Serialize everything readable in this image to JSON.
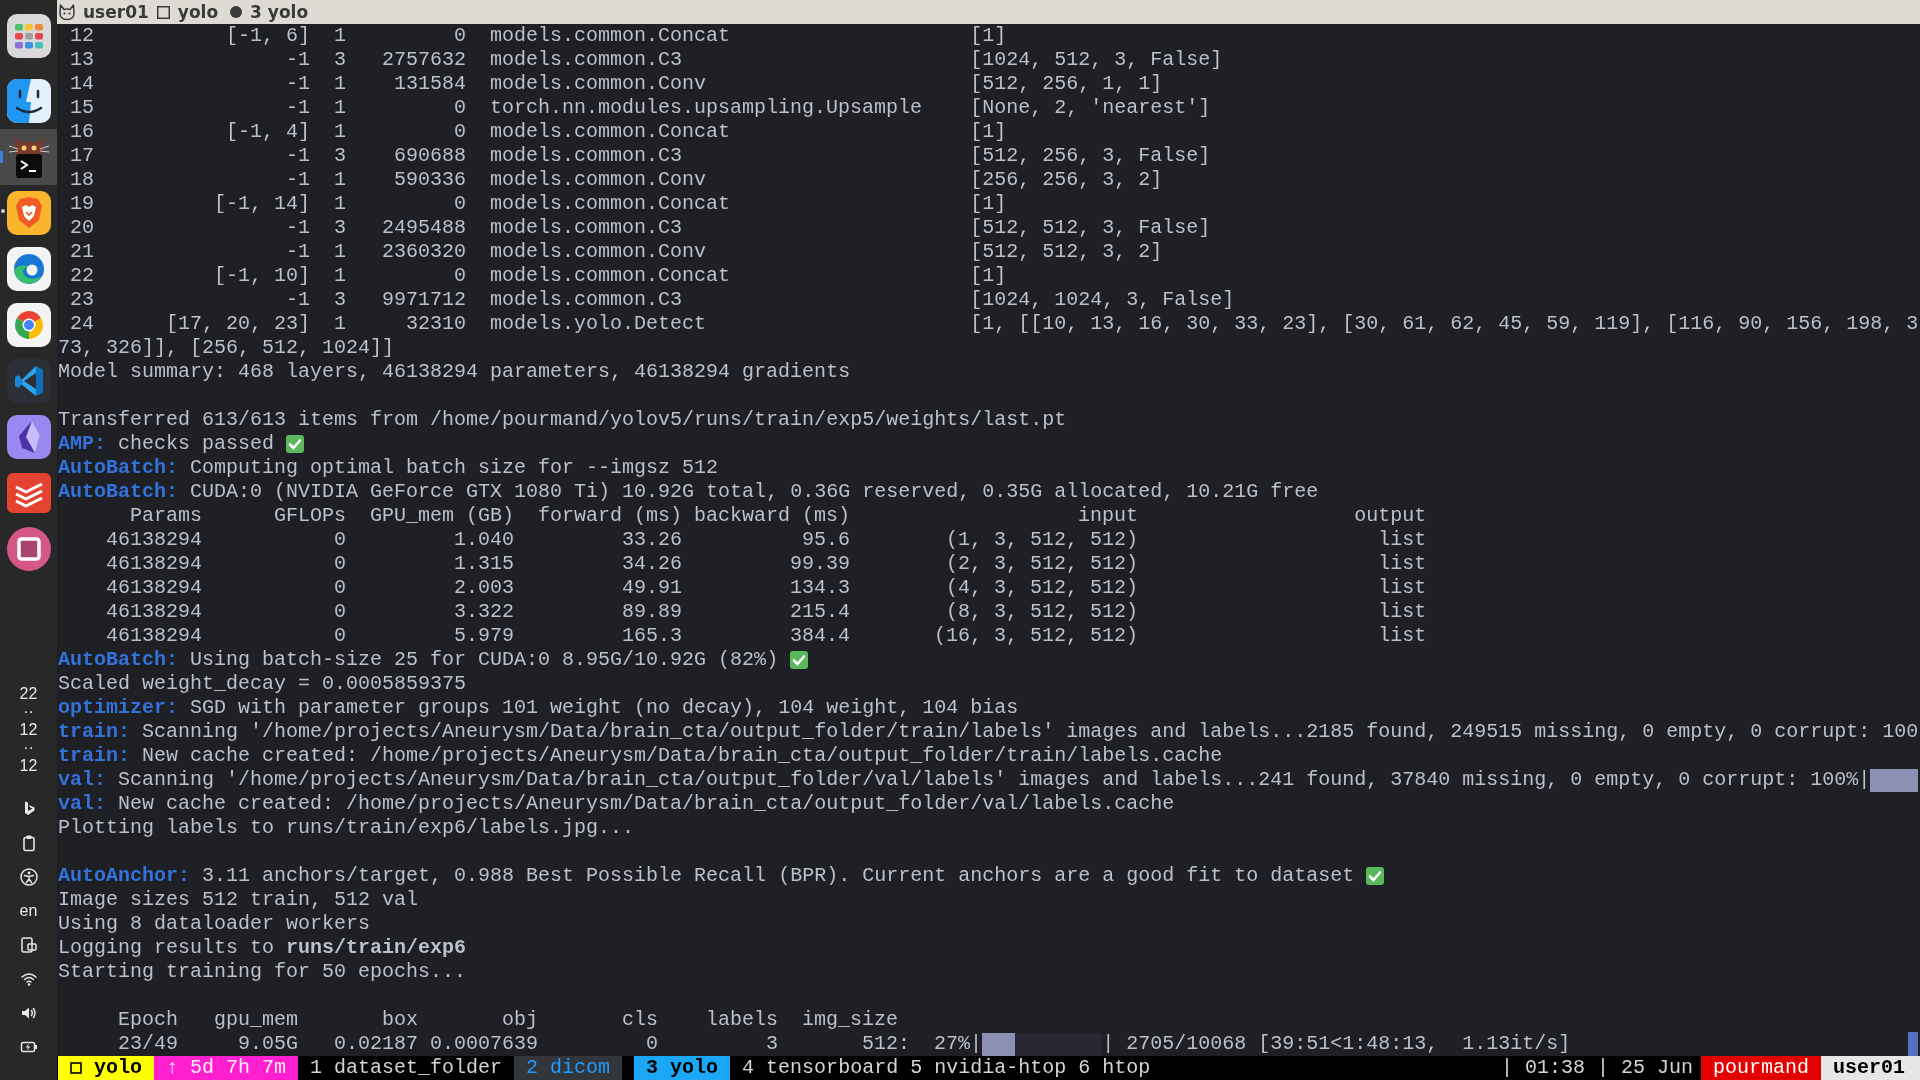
{
  "title_bar": {
    "user": "user01",
    "session": "yolo",
    "window": "3 yolo"
  },
  "dock": {
    "apps": [
      {
        "selected": false,
        "running": false
      },
      {
        "selected": false,
        "running": false
      },
      {
        "selected": true,
        "running": false
      },
      {
        "selected": false,
        "running": true
      },
      {
        "selected": false,
        "running": false
      },
      {
        "selected": false,
        "running": false
      },
      {
        "selected": false,
        "running": false
      },
      {
        "selected": false,
        "running": false
      },
      {
        "selected": false,
        "running": false
      },
      {
        "selected": false,
        "running": false
      }
    ],
    "clock": [
      "22",
      "··",
      "12",
      "··",
      "12"
    ],
    "language": "en"
  },
  "terminal": {
    "lines": [
      {
        "kind": "layer",
        "column_1": "12",
        "column_2": "[-1, 6]",
        "column_3": "1",
        "column_4": "0",
        "column_5": "models.common.Concat",
        "column_6": "[1]"
      },
      {
        "kind": "layer",
        "column_1": "13",
        "column_2": "-1",
        "column_3": "3",
        "column_4": "2757632",
        "column_5": "models.common.C3",
        "column_6": "[1024, 512, 3, False]"
      },
      {
        "kind": "layer",
        "column_1": "14",
        "column_2": "-1",
        "column_3": "1",
        "column_4": "131584",
        "column_5": "models.common.Conv",
        "column_6": "[512, 256, 1, 1]"
      },
      {
        "kind": "layer",
        "column_1": "15",
        "column_2": "-1",
        "column_3": "1",
        "column_4": "0",
        "column_5": "torch.nn.modules.upsampling.Upsample",
        "column_6": "[None, 2, 'nearest']"
      },
      {
        "kind": "layer",
        "column_1": "16",
        "column_2": "[-1, 4]",
        "column_3": "1",
        "column_4": "0",
        "column_5": "models.common.Concat",
        "column_6": "[1]"
      },
      {
        "kind": "layer",
        "column_1": "17",
        "column_2": "-1",
        "column_3": "3",
        "column_4": "690688",
        "column_5": "models.common.C3",
        "column_6": "[512, 256, 3, False]"
      },
      {
        "kind": "layer",
        "column_1": "18",
        "column_2": "-1",
        "column_3": "1",
        "column_4": "590336",
        "column_5": "models.common.Conv",
        "column_6": "[256, 256, 3, 2]"
      },
      {
        "kind": "layer",
        "column_1": "19",
        "column_2": "[-1, 14]",
        "column_3": "1",
        "column_4": "0",
        "column_5": "models.common.Concat",
        "column_6": "[1]"
      },
      {
        "kind": "layer",
        "column_1": "20",
        "column_2": "-1",
        "column_3": "3",
        "column_4": "2495488",
        "column_5": "models.common.C3",
        "column_6": "[512, 512, 3, False]"
      },
      {
        "kind": "layer",
        "column_1": "21",
        "column_2": "-1",
        "column_3": "1",
        "column_4": "2360320",
        "column_5": "models.common.Conv",
        "column_6": "[512, 512, 3, 2]"
      },
      {
        "kind": "layer",
        "column_1": "22",
        "column_2": "[-1, 10]",
        "column_3": "1",
        "column_4": "0",
        "column_5": "models.common.Concat",
        "column_6": "[1]"
      },
      {
        "kind": "layer",
        "column_1": "23",
        "column_2": "-1",
        "column_3": "3",
        "column_4": "9971712",
        "column_5": "models.common.C3",
        "column_6": "[1024, 1024, 3, False]"
      },
      {
        "kind": "layer",
        "column_1": "24",
        "column_2": "[17, 20, 23]",
        "column_3": "1",
        "column_4": "32310",
        "column_5": "models.yolo.Detect",
        "column_6": "[1, [[10, 13, 16, 30, 33, 23], [30, 61, 62, 45, 59, 119], [116, 90, 156, 198, 3"
      },
      {
        "kind": "plain",
        "text": "73, 326]], [256, 512, 1024]]"
      },
      {
        "kind": "plain",
        "text": "Model summary: 468 layers, 46138294 parameters, 46138294 gradients"
      },
      {
        "kind": "blank"
      },
      {
        "kind": "plain",
        "text": "Transferred 613/613 items from /home/pourmand/yolov5/runs/train/exp5/weights/last.pt"
      },
      {
        "kind": "tagged",
        "tag": "AMP:",
        "text": "checks passed",
        "passed": true
      },
      {
        "kind": "tagged",
        "tag": "AutoBatch:",
        "text": "Computing optimal batch size for --imgsz 512"
      },
      {
        "kind": "tagged",
        "tag": "AutoBatch:",
        "text": "CUDA:0 (NVIDIA GeForce GTX 1080 Ti) 10.92G total, 0.36G reserved, 0.35G allocated, 10.21G free"
      },
      {
        "kind": "bench_header",
        "cells": [
          "Params",
          "GFLOPs",
          "GPU_mem (GB)",
          "forward (ms)",
          "backward (ms)",
          "input",
          "output"
        ]
      },
      {
        "kind": "bench_row",
        "cells": [
          "46138294",
          "0",
          "1.040",
          "33.26",
          "95.6",
          "(1, 3, 512, 512)",
          "list"
        ]
      },
      {
        "kind": "bench_row",
        "cells": [
          "46138294",
          "0",
          "1.315",
          "34.26",
          "99.39",
          "(2, 3, 512, 512)",
          "list"
        ]
      },
      {
        "kind": "bench_row",
        "cells": [
          "46138294",
          "0",
          "2.003",
          "49.91",
          "134.3",
          "(4, 3, 512, 512)",
          "list"
        ]
      },
      {
        "kind": "bench_row",
        "cells": [
          "46138294",
          "0",
          "3.322",
          "89.89",
          "215.4",
          "(8, 3, 512, 512)",
          "list"
        ]
      },
      {
        "kind": "bench_row",
        "cells": [
          "46138294",
          "0",
          "5.979",
          "165.3",
          "384.4",
          "(16, 3, 512, 512)",
          "list"
        ]
      },
      {
        "kind": "tagged",
        "tag": "AutoBatch:",
        "text": "Using batch-size 25 for CUDA:0 8.95G/10.92G (82%)",
        "passed": true
      },
      {
        "kind": "plain",
        "text": "Scaled weight_decay = 0.0005859375"
      },
      {
        "kind": "tagged",
        "tag": "optimizer:",
        "text": "SGD with parameter groups 101 weight (no decay), 104 weight, 104 bias"
      },
      {
        "kind": "tagged",
        "tag": "train:",
        "text": "Scanning '/home/projects/Aneurysm/Data/brain_cta/output_folder/train/labels' images and labels...2185 found, 249515 missing, 0 empty, 0 corrupt: 100"
      },
      {
        "kind": "tagged",
        "tag": "train:",
        "text": "New cache created: /home/projects/Aneurysm/Data/brain_cta/output_folder/train/labels.cache"
      },
      {
        "kind": "tagged",
        "tag": "val:",
        "text": "Scanning '/home/projects/Aneurysm/Data/brain_cta/output_folder/val/labels' images and labels...241 found, 37840 missing, 0 empty, 0 corrupt: 100%|",
        "level": 1
      },
      {
        "kind": "tagged",
        "tag": "val:",
        "text": "New cache created: /home/projects/Aneurysm/Data/brain_cta/output_folder/val/labels.cache"
      },
      {
        "kind": "plain",
        "text": "Plotting labels to runs/train/exp6/labels.jpg..."
      },
      {
        "kind": "blank"
      },
      {
        "kind": "tagged",
        "tag": "AutoAnchor:",
        "text": "3.11 anchors/target, 0.988 Best Possible Recall (BPR). Current anchors are a good fit to dataset",
        "passed": true
      },
      {
        "kind": "plain",
        "text": "Image sizes 512 train, 512 val"
      },
      {
        "kind": "plain",
        "text": "Using 8 dataloader workers"
      },
      {
        "kind": "plain",
        "text": "Logging results to **runs/train/exp6**"
      },
      {
        "kind": "plain",
        "text": "Starting training for 50 epochs..."
      },
      {
        "kind": "blank"
      },
      {
        "kind": "epoch_header",
        "cells": [
          "Epoch",
          "gpu_mem",
          "box",
          "obj",
          "cls",
          "labels",
          "img_size"
        ]
      },
      {
        "kind": "epoch_row",
        "cells": [
          "23/49",
          "9.05G",
          "0.02187",
          "0.0007639",
          "0",
          "3",
          "512:"
        ],
        "percent": "27%|",
        "level": 0.27,
        "counter": "| 2705/10068 [39:51<1:48:13,  1.13it/s]"
      }
    ]
  },
  "status_bar": {
    "session": "yolo",
    "uptime": "↑ 5d 7h 7m",
    "windows": [
      {
        "label": "1 dataset_folder",
        "selected": false,
        "last": false
      },
      {
        "label": "2 dicom",
        "selected": false,
        "last": true
      },
      {
        "label": "3 yolo",
        "selected": true,
        "last": false
      },
      {
        "label": "4 tensorboard",
        "selected": false,
        "last": false
      },
      {
        "label": "5 nvidia-htop",
        "selected": false,
        "last": false
      },
      {
        "label": "6 htop",
        "selected": false,
        "last": false
      }
    ],
    "clock": "| 01:38 | 25 Jun",
    "host": "pourmand",
    "user": "user01"
  }
}
